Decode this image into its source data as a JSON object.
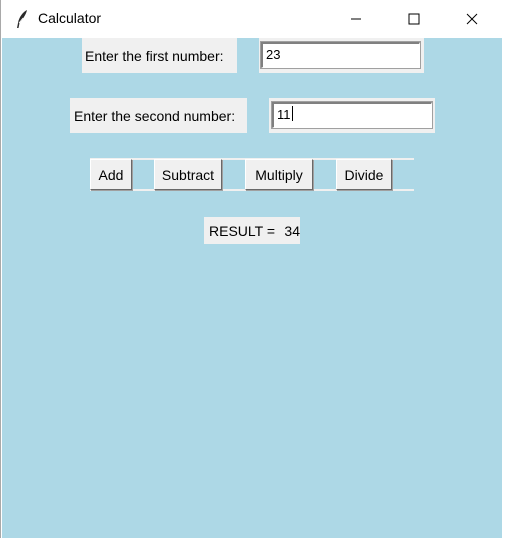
{
  "window": {
    "title": "Calculator",
    "controls": [
      "minimize",
      "maximize",
      "close"
    ]
  },
  "colors": {
    "client_background": "#add8e6",
    "widget_background": "#f0f0f0"
  },
  "form": {
    "first_label": "Enter the first number:",
    "first_value": "23",
    "second_label": "Enter the second number:",
    "second_value": "11"
  },
  "buttons": {
    "add": "Add",
    "subtract": "Subtract",
    "multiply": "Multiply",
    "divide": "Divide"
  },
  "result": {
    "label": "RESULT =",
    "value": "34"
  }
}
